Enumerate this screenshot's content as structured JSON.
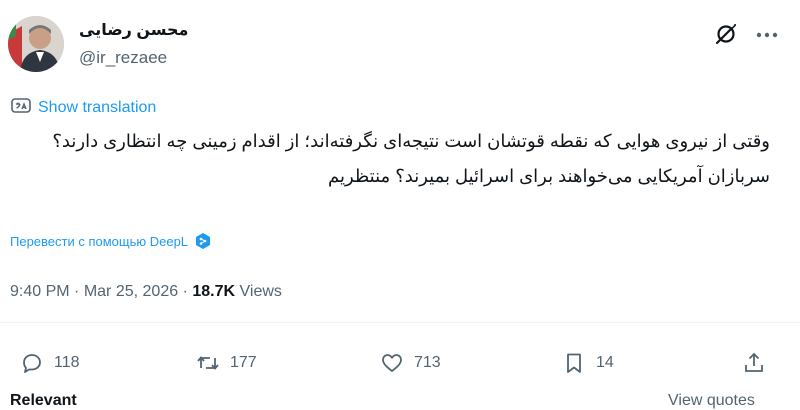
{
  "author": {
    "display_name": "محسن رضایی",
    "handle": "@ir_rezaee",
    "avatar_icon": "avatar-photo"
  },
  "header": {
    "grok_icon": "grok-icon",
    "more_icon": "more-horizontal-icon"
  },
  "translation": {
    "show_label": "Show translation",
    "icon": "translate-icon"
  },
  "tweet": {
    "paragraphs": [
      "وقتی از نیروی هوایی که نقطه قوتشان است نتیجه‌ای نگرفته‌اند؛ از اقدام زمینی چه انتظاری دارند؟",
      "سربازان آمریکایی می‌خواهند برای اسرائیل بمیرند؟ منتظریم"
    ]
  },
  "deepl": {
    "label": "Перевести с помощью DeepL",
    "icon": "deepl-logo-icon"
  },
  "meta": {
    "time": "9:40 PM",
    "date": "Mar 25, 2026",
    "views_count": "18.7K",
    "views_label": "Views"
  },
  "actions": {
    "replies": "118",
    "reposts": "177",
    "likes": "713",
    "bookmarks": "14"
  },
  "footer": {
    "left_text": "Relevant",
    "right_text": "View quotes"
  },
  "colors": {
    "accent": "#1d9bf0",
    "text": "#0f1419",
    "muted": "#536471",
    "divider": "#eff3f4"
  }
}
